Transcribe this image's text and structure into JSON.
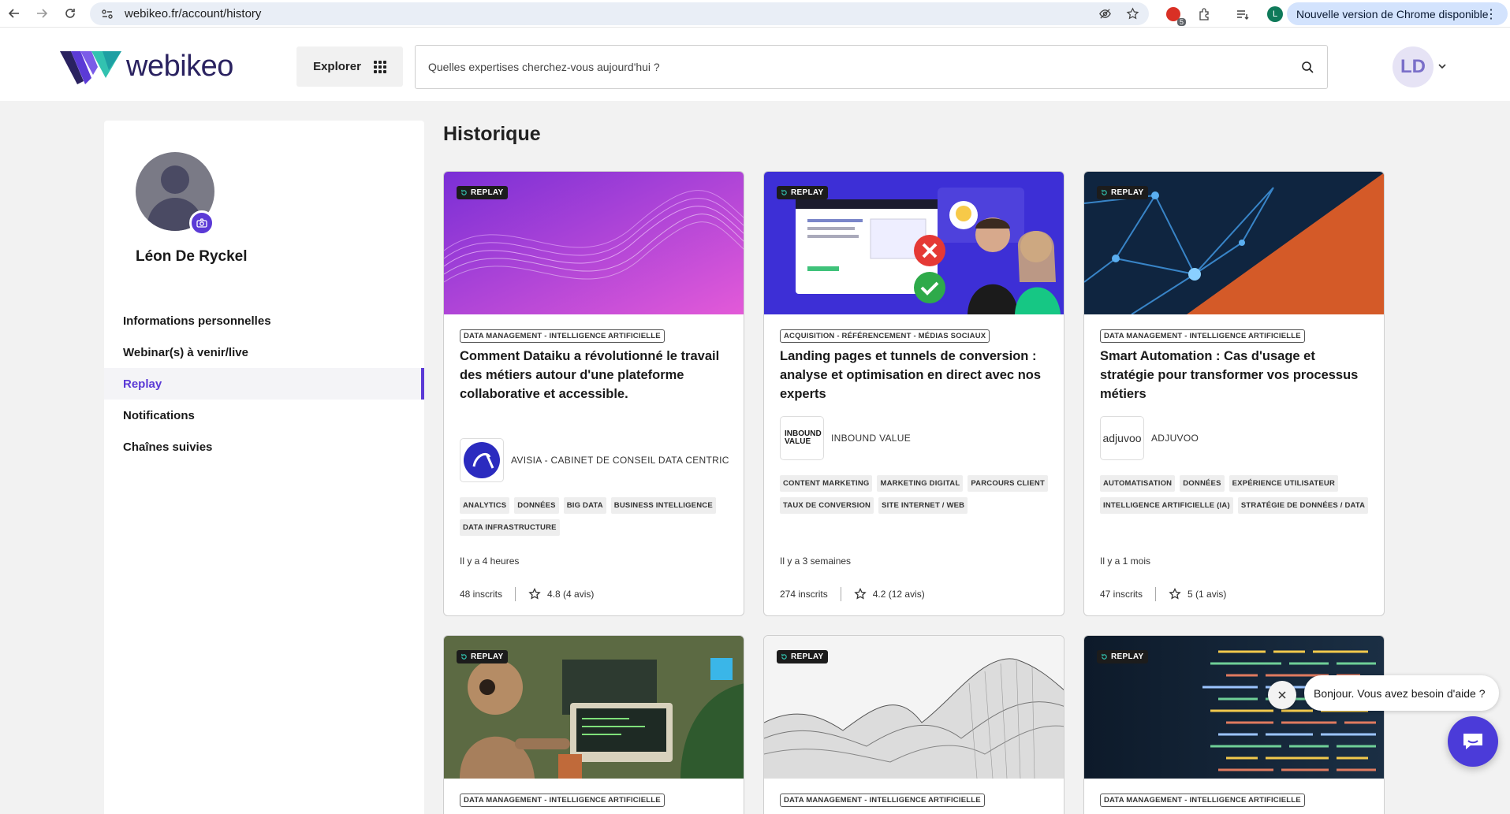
{
  "browser": {
    "url": "webikeo.fr/account/history",
    "update_label": "Nouvelle version de Chrome disponible",
    "profile_initial": "L",
    "extension_badge": "5"
  },
  "header": {
    "logo_text": "webikeo",
    "explore_label": "Explorer",
    "search_placeholder": "Quelles expertises cherchez-vous aujourd'hui ?",
    "avatar_initials": "LD"
  },
  "sidebar": {
    "user_name": "Léon De Ryckel",
    "items": [
      {
        "label": "Informations personnelles",
        "active": false
      },
      {
        "label": "Webinar(s) à venir/live",
        "active": false
      },
      {
        "label": "Replay",
        "active": true
      },
      {
        "label": "Notifications",
        "active": false
      },
      {
        "label": "Chaînes suivies",
        "active": false
      }
    ]
  },
  "main": {
    "title": "Historique",
    "badge_label": "REPLAY",
    "cards": [
      {
        "category": "DATA MANAGEMENT - INTELLIGENCE ARTIFICIELLE",
        "title": "Comment Dataiku a révolutionné le travail des métiers autour d'une plateforme collaborative et accessible.",
        "org": "AVISIA - CABINET DE CONSEIL DATA CENTRIC",
        "tags": [
          "ANALYTICS",
          "DONNÉES",
          "BIG DATA",
          "BUSINESS INTELLIGENCE",
          "DATA INFRASTRUCTURE"
        ],
        "time_ago": "Il y a 4 heures",
        "subscribers": "48 inscrits",
        "rating": "4.8 (4 avis)"
      },
      {
        "category": "ACQUISITION - RÉFÉRENCEMENT - MÉDIAS SOCIAUX",
        "title": "Landing pages et tunnels de conversion : analyse et optimisation en direct avec nos experts",
        "org": "INBOUND VALUE",
        "org_logo_text": "INBOUND VALUE",
        "tags": [
          "CONTENT MARKETING",
          "MARKETING DIGITAL",
          "PARCOURS CLIENT",
          "TAUX DE CONVERSION",
          "SITE INTERNET / WEB"
        ],
        "time_ago": "Il y a 3 semaines",
        "subscribers": "274 inscrits",
        "rating": "4.2 (12 avis)"
      },
      {
        "category": "DATA MANAGEMENT - INTELLIGENCE ARTIFICIELLE",
        "title": "Smart Automation : Cas d'usage et stratégie pour transformer vos processus métiers",
        "org": "ADJUVOO",
        "org_logo_text": "adjuvoo",
        "tags": [
          "AUTOMATISATION",
          "DONNÉES",
          "EXPÉRIENCE UTILISATEUR",
          "INTELLIGENCE ARTIFICIELLE (IA)",
          "STRATÉGIE DE DONNÉES / DATA"
        ],
        "time_ago": "Il y a 1 mois",
        "subscribers": "47 inscrits",
        "rating": "5 (1 avis)"
      },
      {
        "category": "DATA MANAGEMENT - INTELLIGENCE ARTIFICIELLE"
      },
      {
        "category": "DATA MANAGEMENT - INTELLIGENCE ARTIFICIELLE"
      },
      {
        "category": "DATA MANAGEMENT - INTELLIGENCE ARTIFICIELLE"
      }
    ]
  },
  "chat": {
    "greeting": "Bonjour. Vous avez besoin d'aide ?"
  },
  "colors": {
    "accent": "#5b3ad6",
    "logo_text": "#2a2260",
    "chat_button": "#4b3bd9"
  }
}
